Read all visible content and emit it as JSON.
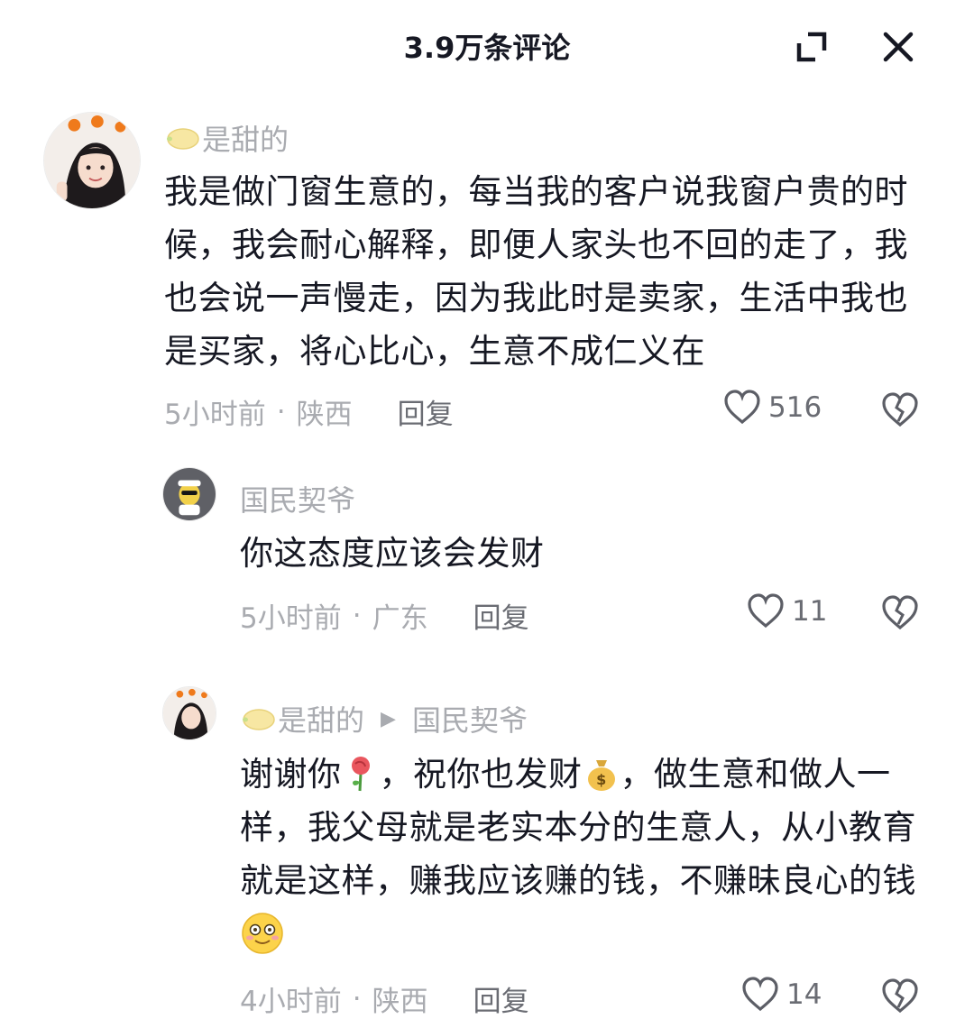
{
  "header": {
    "title": "3.9万条评论"
  },
  "comments": [
    {
      "username": "是甜的",
      "text": "我是做门窗生意的，每当我的客户说我窗户贵的时候，我会耐心解释，即便人家头也不回的走了，我也会说一声慢走，因为我此时是卖家，生活中我也是买家，将心比心，生意不成仁义在",
      "time": "5小时前",
      "location": "陕西",
      "reply_label": "回复",
      "likes": "516"
    },
    {
      "username": "国民契爷",
      "text": "你这态度应该会发财",
      "time": "5小时前",
      "location": "广东",
      "reply_label": "回复",
      "likes": "11"
    },
    {
      "username": "是甜的",
      "reply_to": "国民契爷",
      "text_parts": [
        "谢谢你",
        "，祝你也发财",
        "，做生意和做人一样，我父母就是老实本分的生意人，从小教育就是这样，赚我应该赚的钱，不赚昧良心的钱"
      ],
      "time": "4小时前",
      "location": "陕西",
      "reply_label": "回复",
      "likes": "14"
    }
  ],
  "icons": {
    "expand": "expand-icon",
    "close": "close-icon",
    "like": "heart-outline-icon",
    "dislike": "broken-heart-icon",
    "rose": "rose-emoji",
    "money_bag": "money-bag-emoji",
    "smile": "flushed-smile-emoji",
    "lemon": "lemon-emoji"
  }
}
